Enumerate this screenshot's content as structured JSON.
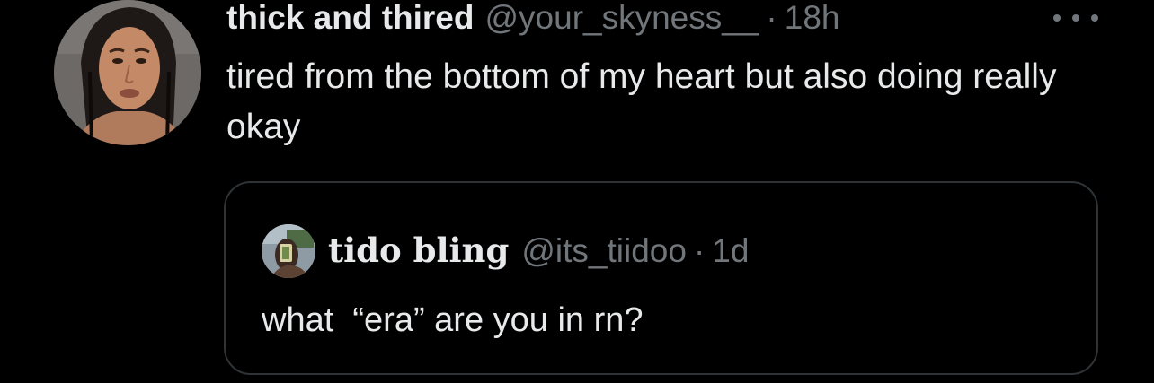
{
  "tweet": {
    "display_name": "thick and thired",
    "handle": "@your_skyness__",
    "separator": "·",
    "time": "18h",
    "avatar_icon": "user-avatar-photo",
    "more_icon": "ellipsis-icon",
    "text": "tired from the bottom of my heart but also doing really okay"
  },
  "quoted_tweet": {
    "display_name": "tido bling",
    "handle": "@its_tiidoo",
    "separator": "·",
    "time": "1d",
    "avatar_icon": "user-avatar-photo",
    "text": "what  “era” are you in rn?"
  },
  "colors": {
    "background": "#000000",
    "primary_text": "#e7e9ea",
    "secondary_text": "#71767b",
    "border": "#2f3336"
  }
}
